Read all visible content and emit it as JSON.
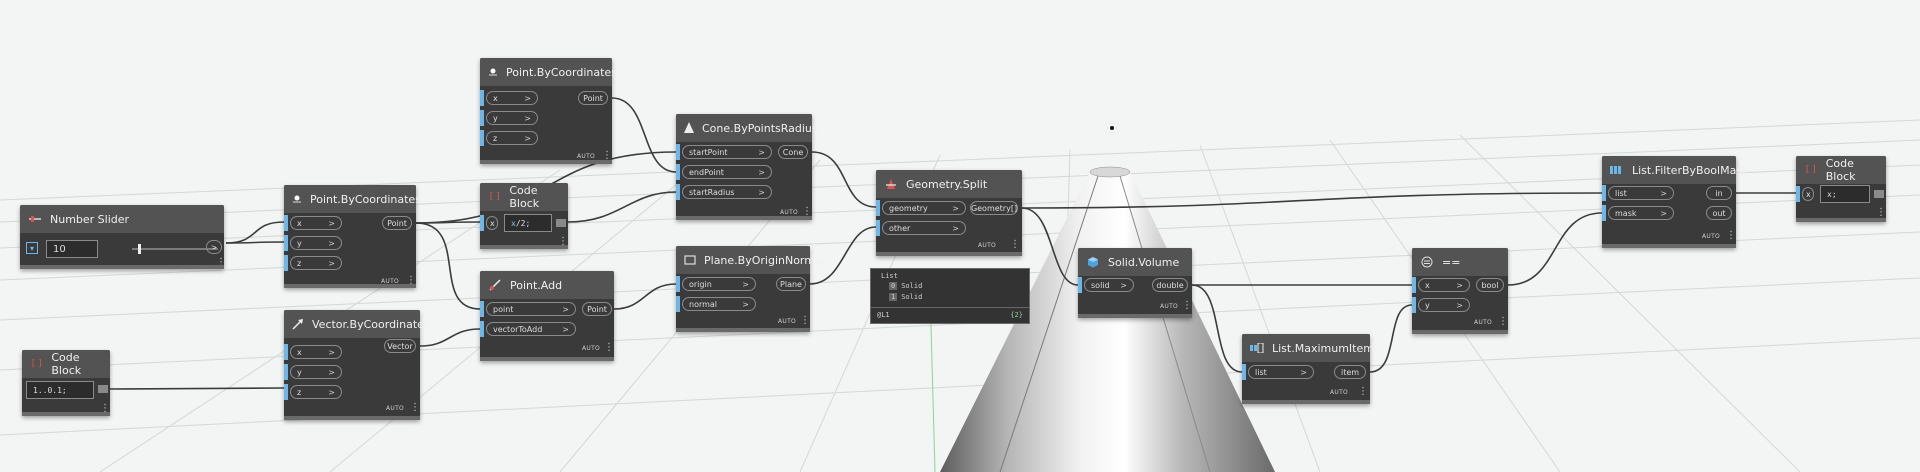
{
  "theme": {
    "node_bg": "#3a3a3a",
    "header_bg": "#535353",
    "port_accent": "#6cb6e8",
    "wire": "#3c3c3c"
  },
  "auto_label": "AUTO",
  "nodes": {
    "slider": {
      "title": "Number Slider",
      "value": "10",
      "out": ">"
    },
    "pt1": {
      "title": "Point.ByCoordinates",
      "inputs": [
        "x",
        "y",
        "z"
      ],
      "out": "Point"
    },
    "pt2": {
      "title": "Point.ByCoordinates",
      "inputs": [
        "x",
        "y",
        "z"
      ],
      "out": "Point"
    },
    "cb1": {
      "title": "Code Block",
      "in": "x",
      "code_var": "x",
      "code_rest": "/2;"
    },
    "cone": {
      "title": "Cone.ByPointsRadius",
      "inputs": [
        "startPoint",
        "endPoint",
        "startRadius"
      ],
      "out": "Cone"
    },
    "padd": {
      "title": "Point.Add",
      "inputs": [
        "point",
        "vectorToAdd"
      ],
      "out": "Point"
    },
    "plane": {
      "title": "Plane.ByOriginNormal",
      "inputs": [
        "origin",
        "normal"
      ],
      "out": "Plane"
    },
    "split": {
      "title": "Geometry.Split",
      "inputs": [
        "geometry",
        "other"
      ],
      "out": "Geometry[]"
    },
    "vec": {
      "title": "Vector.ByCoordinates",
      "inputs": [
        "x",
        "y",
        "z"
      ],
      "out": "Vector"
    },
    "cb2": {
      "title": "Code Block",
      "code": "1..0.1;"
    },
    "vol": {
      "title": "Solid.Volume",
      "in": "solid",
      "out": "double"
    },
    "maxi": {
      "title": "List.MaximumItem",
      "in": "list",
      "out": "item"
    },
    "eq": {
      "title": "==",
      "inputs": [
        "x",
        "y"
      ],
      "out": "bool"
    },
    "filt": {
      "title": "List.FilterByBoolMask",
      "inputs": [
        "list",
        "mask"
      ],
      "outs": [
        "in",
        "out"
      ]
    },
    "cb3": {
      "title": "Code Block",
      "in": "x",
      "code": "x;"
    }
  },
  "split_preview": {
    "header": "List",
    "rows": [
      {
        "idx": "0",
        "val": "Solid"
      },
      {
        "idx": "1",
        "val": "Solid"
      }
    ],
    "footer_left": "@L1",
    "footer_right": "{2}"
  }
}
